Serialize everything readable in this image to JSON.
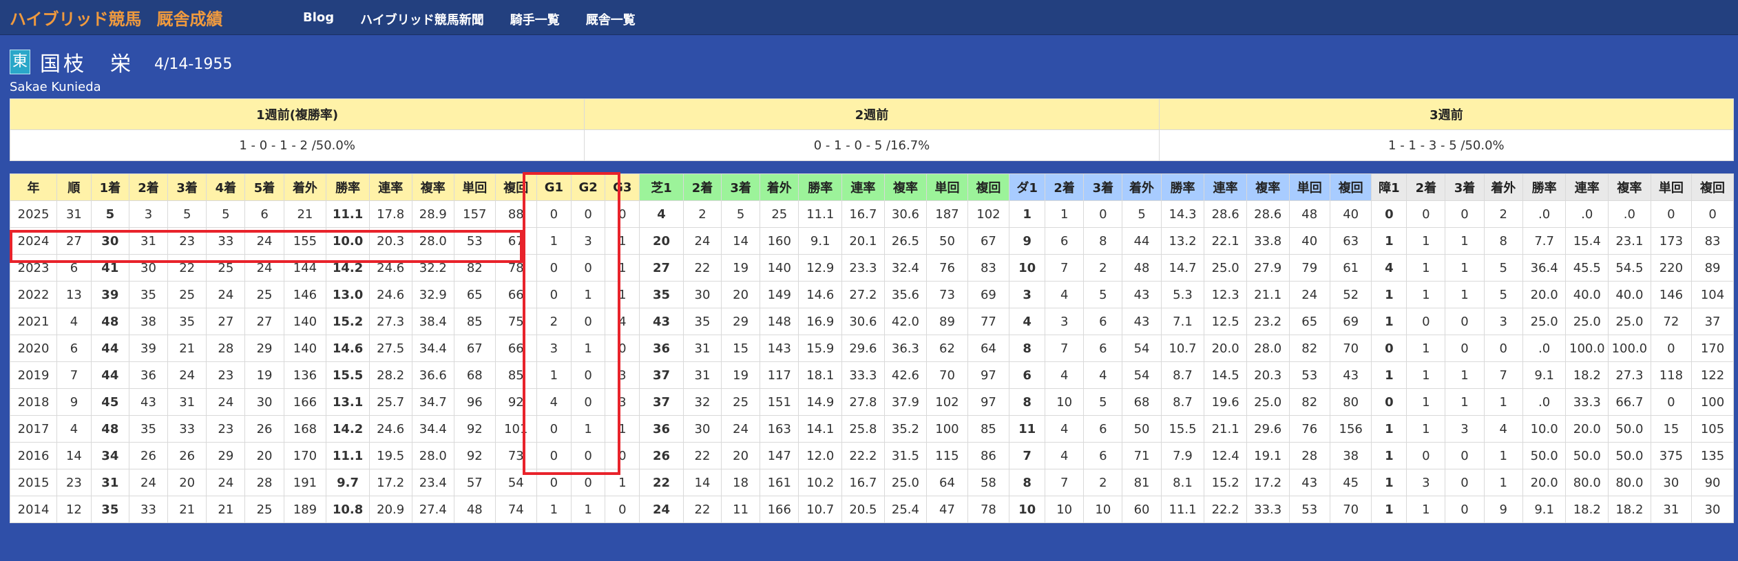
{
  "nav": {
    "brand": "ハイブリッド競馬",
    "brand_sub": "厩舎成績",
    "links": [
      "Blog",
      "ハイブリッド競馬新聞",
      "騎手一覧",
      "厩舎一覧"
    ]
  },
  "profile": {
    "badge": "東",
    "name": "国枝　栄",
    "date": "4/14-1955",
    "english_name": "Sakae Kunieda"
  },
  "weekly": {
    "headers": [
      "1週前(複勝率)",
      "2週前",
      "3週前"
    ],
    "values": [
      "1 - 0 - 1 - 2 /50.0%",
      "0 - 1 - 0 - 5 /16.7%",
      "1 - 1 - 3 - 5 /50.0%"
    ]
  },
  "stats": {
    "headers": [
      "年",
      "順",
      "1着",
      "2着",
      "3着",
      "4着",
      "5着",
      "着外",
      "勝率",
      "連率",
      "複率",
      "単回",
      "複回",
      "G1",
      "G2",
      "G3",
      "芝1",
      "2着",
      "3着",
      "着外",
      "勝率",
      "連率",
      "複率",
      "単回",
      "複回",
      "ダ1",
      "2着",
      "3着",
      "着外",
      "勝率",
      "連率",
      "複率",
      "単回",
      "複回",
      "障1",
      "2着",
      "3着",
      "着外",
      "勝率",
      "連率",
      "複率",
      "単回",
      "複回"
    ],
    "rows": [
      [
        "2025",
        "31",
        "5",
        "3",
        "5",
        "5",
        "6",
        "21",
        "11.1",
        "17.8",
        "28.9",
        "157",
        "88",
        "0",
        "0",
        "0",
        "4",
        "2",
        "5",
        "25",
        "11.1",
        "16.7",
        "30.6",
        "187",
        "102",
        "1",
        "1",
        "0",
        "5",
        "14.3",
        "28.6",
        "28.6",
        "48",
        "40",
        "0",
        "0",
        "0",
        "2",
        ".0",
        ".0",
        ".0",
        "0",
        "0"
      ],
      [
        "2024",
        "27",
        "30",
        "31",
        "23",
        "33",
        "24",
        "155",
        "10.0",
        "20.3",
        "28.0",
        "53",
        "67",
        "1",
        "3",
        "1",
        "20",
        "24",
        "14",
        "160",
        "9.1",
        "20.1",
        "26.5",
        "50",
        "67",
        "9",
        "6",
        "8",
        "44",
        "13.2",
        "22.1",
        "33.8",
        "40",
        "63",
        "1",
        "1",
        "1",
        "8",
        "7.7",
        "15.4",
        "23.1",
        "173",
        "83"
      ],
      [
        "2023",
        "6",
        "41",
        "30",
        "22",
        "25",
        "24",
        "144",
        "14.2",
        "24.6",
        "32.2",
        "82",
        "78",
        "0",
        "0",
        "1",
        "27",
        "22",
        "19",
        "140",
        "12.9",
        "23.3",
        "32.4",
        "76",
        "83",
        "10",
        "7",
        "2",
        "48",
        "14.7",
        "25.0",
        "27.9",
        "79",
        "61",
        "4",
        "1",
        "1",
        "5",
        "36.4",
        "45.5",
        "54.5",
        "220",
        "89"
      ],
      [
        "2022",
        "13",
        "39",
        "35",
        "25",
        "24",
        "25",
        "146",
        "13.0",
        "24.6",
        "32.9",
        "65",
        "66",
        "0",
        "1",
        "1",
        "35",
        "30",
        "20",
        "149",
        "14.6",
        "27.2",
        "35.6",
        "73",
        "69",
        "3",
        "4",
        "5",
        "43",
        "5.3",
        "12.3",
        "21.1",
        "24",
        "52",
        "1",
        "1",
        "1",
        "5",
        "20.0",
        "40.0",
        "40.0",
        "146",
        "104"
      ],
      [
        "2021",
        "4",
        "48",
        "38",
        "35",
        "27",
        "27",
        "140",
        "15.2",
        "27.3",
        "38.4",
        "85",
        "75",
        "2",
        "0",
        "4",
        "43",
        "35",
        "29",
        "148",
        "16.9",
        "30.6",
        "42.0",
        "89",
        "77",
        "4",
        "3",
        "6",
        "43",
        "7.1",
        "12.5",
        "23.2",
        "65",
        "69",
        "1",
        "0",
        "0",
        "3",
        "25.0",
        "25.0",
        "25.0",
        "72",
        "37"
      ],
      [
        "2020",
        "6",
        "44",
        "39",
        "21",
        "28",
        "29",
        "140",
        "14.6",
        "27.5",
        "34.4",
        "67",
        "66",
        "3",
        "1",
        "0",
        "36",
        "31",
        "15",
        "143",
        "15.9",
        "29.6",
        "36.3",
        "62",
        "64",
        "8",
        "7",
        "6",
        "54",
        "10.7",
        "20.0",
        "28.0",
        "82",
        "70",
        "0",
        "1",
        "0",
        "0",
        ".0",
        "100.0",
        "100.0",
        "0",
        "170"
      ],
      [
        "2019",
        "7",
        "44",
        "36",
        "24",
        "23",
        "19",
        "136",
        "15.5",
        "28.2",
        "36.6",
        "68",
        "85",
        "1",
        "0",
        "3",
        "37",
        "31",
        "19",
        "117",
        "18.1",
        "33.3",
        "42.6",
        "70",
        "97",
        "6",
        "4",
        "4",
        "54",
        "8.7",
        "14.5",
        "20.3",
        "53",
        "43",
        "1",
        "1",
        "1",
        "7",
        "9.1",
        "18.2",
        "27.3",
        "118",
        "122"
      ],
      [
        "2018",
        "9",
        "45",
        "43",
        "31",
        "24",
        "30",
        "166",
        "13.1",
        "25.7",
        "34.7",
        "96",
        "92",
        "4",
        "0",
        "3",
        "37",
        "32",
        "25",
        "151",
        "14.9",
        "27.8",
        "37.9",
        "102",
        "97",
        "8",
        "10",
        "5",
        "68",
        "8.7",
        "19.6",
        "25.0",
        "82",
        "80",
        "0",
        "1",
        "1",
        "1",
        ".0",
        "33.3",
        "66.7",
        "0",
        "100"
      ],
      [
        "2017",
        "4",
        "48",
        "35",
        "33",
        "23",
        "26",
        "168",
        "14.2",
        "24.6",
        "34.4",
        "92",
        "101",
        "0",
        "1",
        "1",
        "36",
        "30",
        "24",
        "163",
        "14.1",
        "25.8",
        "35.2",
        "100",
        "85",
        "11",
        "4",
        "6",
        "50",
        "15.5",
        "21.1",
        "29.6",
        "76",
        "156",
        "1",
        "1",
        "3",
        "4",
        "10.0",
        "20.0",
        "50.0",
        "15",
        "105"
      ],
      [
        "2016",
        "14",
        "34",
        "26",
        "26",
        "29",
        "20",
        "170",
        "11.1",
        "19.5",
        "28.0",
        "92",
        "73",
        "0",
        "0",
        "0",
        "26",
        "22",
        "20",
        "147",
        "12.0",
        "22.2",
        "31.5",
        "115",
        "86",
        "7",
        "4",
        "6",
        "71",
        "7.9",
        "12.4",
        "19.1",
        "28",
        "38",
        "1",
        "0",
        "0",
        "1",
        "50.0",
        "50.0",
        "50.0",
        "375",
        "135"
      ],
      [
        "2015",
        "23",
        "31",
        "24",
        "20",
        "24",
        "28",
        "191",
        "9.7",
        "17.2",
        "23.4",
        "57",
        "54",
        "0",
        "0",
        "1",
        "22",
        "14",
        "18",
        "161",
        "10.2",
        "16.7",
        "25.0",
        "64",
        "58",
        "8",
        "7",
        "2",
        "81",
        "8.1",
        "15.2",
        "17.2",
        "43",
        "45",
        "1",
        "3",
        "0",
        "1",
        "20.0",
        "80.0",
        "80.0",
        "30",
        "90"
      ],
      [
        "2014",
        "12",
        "35",
        "33",
        "21",
        "21",
        "25",
        "189",
        "10.8",
        "20.9",
        "27.4",
        "48",
        "74",
        "1",
        "1",
        "0",
        "24",
        "22",
        "11",
        "166",
        "10.7",
        "20.5",
        "25.4",
        "47",
        "78",
        "10",
        "10",
        "10",
        "60",
        "11.1",
        "22.2",
        "33.3",
        "53",
        "70",
        "1",
        "1",
        "0",
        "9",
        "9.1",
        "18.2",
        "18.2",
        "31",
        "30"
      ]
    ]
  },
  "colors": {
    "page_bg": "#2f4fa8",
    "navbar_bg": "#23407f",
    "brand": "#f09a3e",
    "header_all": "#fff2a8",
    "header_turf": "#9cf39a",
    "header_dirt": "#a8ccff",
    "header_jump": "#e9e9e9",
    "highlight": "#e8232b"
  }
}
